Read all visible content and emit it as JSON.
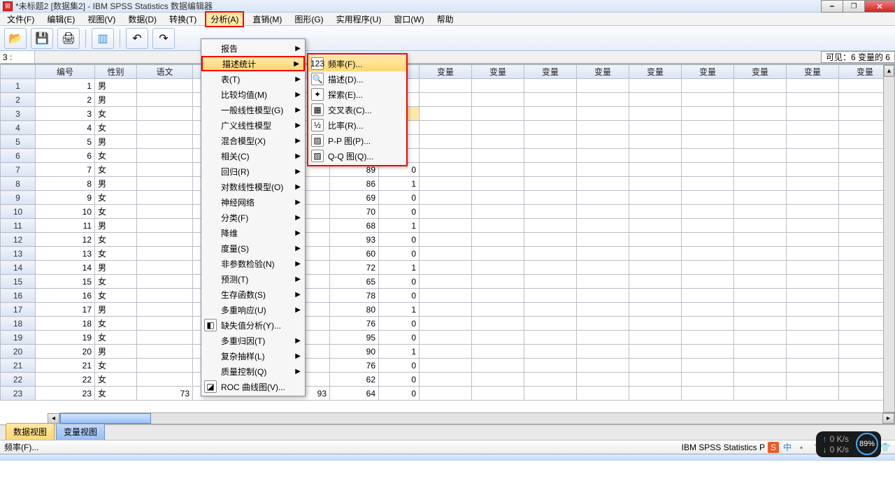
{
  "title": "*未标题2 [数据集2] - IBM SPSS Statistics 数据编辑器",
  "menubar": [
    "文件(F)",
    "编辑(E)",
    "视图(V)",
    "数据(D)",
    "转换(T)",
    "分析(A)",
    "直销(M)",
    "图形(G)",
    "实用程序(U)",
    "窗口(W)",
    "帮助"
  ],
  "cellref": "3 :",
  "visibility": "可见：6 变量的 6",
  "columns": [
    "编号",
    "性别",
    "语文"
  ],
  "extra_vars": [
    "变量",
    "变量",
    "变量",
    "变量",
    "变量",
    "变量",
    "变量",
    "变量",
    "变量",
    "变"
  ],
  "analyze_menu": [
    {
      "label": "报告",
      "arrow": true
    },
    {
      "label": "描述统计",
      "arrow": true,
      "hl": true
    },
    {
      "label": "表(T)",
      "arrow": true
    },
    {
      "label": "比较均值(M)",
      "arrow": true
    },
    {
      "label": "一般线性模型(G)",
      "arrow": true
    },
    {
      "label": "广义线性模型",
      "arrow": true
    },
    {
      "label": "混合模型(X)",
      "arrow": true
    },
    {
      "label": "相关(C)",
      "arrow": true
    },
    {
      "label": "回归(R)",
      "arrow": true
    },
    {
      "label": "对数线性模型(O)",
      "arrow": true
    },
    {
      "label": "神经网络",
      "arrow": true
    },
    {
      "label": "分类(F)",
      "arrow": true
    },
    {
      "label": "降维",
      "arrow": true
    },
    {
      "label": "度量(S)",
      "arrow": true
    },
    {
      "label": "非参数检验(N)",
      "arrow": true
    },
    {
      "label": "预测(T)",
      "arrow": true
    },
    {
      "label": "生存函数(S)",
      "arrow": true
    },
    {
      "label": "多重响应(U)",
      "arrow": true
    },
    {
      "label": "缺失值分析(Y)...",
      "arrow": false,
      "icon": "◧"
    },
    {
      "label": "多重归因(T)",
      "arrow": true
    },
    {
      "label": "复杂抽样(L)",
      "arrow": true
    },
    {
      "label": "质量控制(Q)",
      "arrow": true
    },
    {
      "label": "ROC 曲线图(V)...",
      "arrow": false,
      "icon": "◪"
    }
  ],
  "desc_menu": [
    {
      "label": "频率(F)...",
      "icon": "123",
      "sel": true
    },
    {
      "label": "描述(D)...",
      "icon": "🔍"
    },
    {
      "label": "探索(E)...",
      "icon": "✦"
    },
    {
      "label": "交叉表(C)...",
      "icon": "▦"
    },
    {
      "label": "比率(R)...",
      "icon": "½"
    },
    {
      "label": "P-P 图(P)...",
      "icon": "▨"
    },
    {
      "label": "Q-Q 图(Q)...",
      "icon": "▨"
    }
  ],
  "rows": [
    {
      "n": 1,
      "id": 1,
      "sex": "男"
    },
    {
      "n": 2,
      "id": 2,
      "sex": "男"
    },
    {
      "n": 3,
      "id": 3,
      "sex": "女",
      "hl": true
    },
    {
      "n": 4,
      "id": 4,
      "sex": "女"
    },
    {
      "n": 5,
      "id": 5,
      "sex": "男"
    },
    {
      "n": 6,
      "id": 6,
      "sex": "女"
    },
    {
      "n": 7,
      "id": 7,
      "sex": "女",
      "v1": 89,
      "v2": 0
    },
    {
      "n": 8,
      "id": 8,
      "sex": "男",
      "v1": 86,
      "v2": 1
    },
    {
      "n": 9,
      "id": 9,
      "sex": "女",
      "v1": 69,
      "v2": 0
    },
    {
      "n": 10,
      "id": 10,
      "sex": "女",
      "v1": 70,
      "v2": 0
    },
    {
      "n": 11,
      "id": 11,
      "sex": "男",
      "v1": 68,
      "v2": 1
    },
    {
      "n": 12,
      "id": 12,
      "sex": "女",
      "v1": 93,
      "v2": 0
    },
    {
      "n": 13,
      "id": 13,
      "sex": "女",
      "v1": 60,
      "v2": 0
    },
    {
      "n": 14,
      "id": 14,
      "sex": "男",
      "v1": 72,
      "v2": 1
    },
    {
      "n": 15,
      "id": 15,
      "sex": "女",
      "v1": 65,
      "v2": 0
    },
    {
      "n": 16,
      "id": 16,
      "sex": "女",
      "v1": 78,
      "v2": 0
    },
    {
      "n": 17,
      "id": 17,
      "sex": "男",
      "v1": 80,
      "v2": 1
    },
    {
      "n": 18,
      "id": 18,
      "sex": "女",
      "v1": 76,
      "v2": 0
    },
    {
      "n": 19,
      "id": 19,
      "sex": "女",
      "v1": 95,
      "v2": 0
    },
    {
      "n": 20,
      "id": 20,
      "sex": "男",
      "v1": 90,
      "v2": 1
    },
    {
      "n": 21,
      "id": 21,
      "sex": "女",
      "v1": 76,
      "v2": 0
    },
    {
      "n": 22,
      "id": 22,
      "sex": "女",
      "v1": 62,
      "v2": 0
    },
    {
      "n": 23,
      "id": 23,
      "sex": "女",
      "wen": 73,
      "wext": 93,
      "v1": 64,
      "v2": 0
    }
  ],
  "tabs": {
    "data": "数据视图",
    "var": "变量视图"
  },
  "status_left": "频率(F)...",
  "status_right": "IBM SPSS Statistics P",
  "perf": {
    "up": "0 K/s",
    "dn": "0 K/s",
    "pct": "89%"
  }
}
